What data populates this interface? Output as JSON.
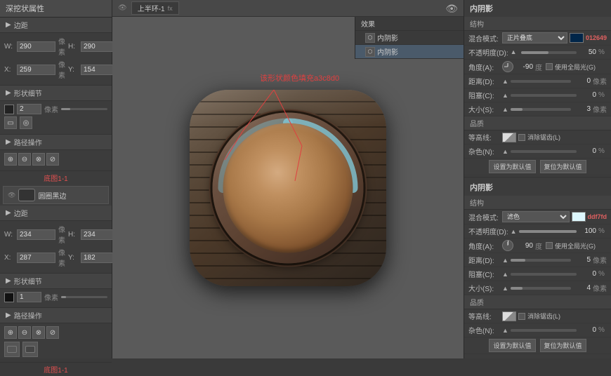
{
  "leftPanel": {
    "title": "深挖状属性",
    "sections": [
      {
        "id": "section1",
        "header": "边距",
        "fields": [
          {
            "label": "W:",
            "value": "290",
            "unit": "像素",
            "label2": "H:",
            "value2": "290",
            "unit2": "像素"
          },
          {
            "label": "X:",
            "value": "259",
            "unit": "像素",
            "label2": "Y:",
            "value2": "154",
            "unit2": "像素"
          }
        ]
      },
      {
        "id": "section2",
        "header": "形状细节",
        "strokeValue": "2",
        "strokeUnit": "像素"
      },
      {
        "id": "section3",
        "header": "路径操作"
      }
    ],
    "layerItem": "圆圈黑边",
    "section4Header": "边距",
    "section4Fields": [
      {
        "label": "W:",
        "value": "234",
        "unit": "像素",
        "label2": "H:",
        "value2": "234",
        "unit2": "像素"
      },
      {
        "label": "X:",
        "value": "287",
        "unit": "像素",
        "label2": "Y:",
        "value2": "182",
        "unit2": "像素"
      }
    ],
    "section5Header": "形状细节",
    "strokeValue2": "1",
    "strokeUnit2": "像素",
    "section6Header": "路径操作",
    "bottomRed1": "底图1-1",
    "bottomRed2": "底图1-1"
  },
  "effectsTree": {
    "layerName": "上半环-1",
    "items": [
      {
        "label": "效果",
        "indent": 0
      },
      {
        "label": "内阴影",
        "indent": 1
      },
      {
        "label": "内阴影",
        "indent": 1
      }
    ]
  },
  "annotation": {
    "text": "该形状颜色填充a3c8d0"
  },
  "rightPanel": {
    "title": "内阴影",
    "section1": {
      "header": "结构",
      "rows": [
        {
          "label": "混合模式:",
          "value": "正片叠底",
          "colorHex": "012649",
          "color": "#012649"
        },
        {
          "label": "不透明度(D):",
          "value": "50",
          "unit": "%"
        },
        {
          "label": "角度(A):",
          "dialAngle": -90,
          "value": "-90",
          "unit": "度",
          "checkbox": "使用全局光(G)"
        },
        {
          "label": "距离(D):",
          "value": "0",
          "unit": "像素"
        },
        {
          "label": "阻塞(C):",
          "value": "0",
          "unit": "%"
        },
        {
          "label": "大小(S):",
          "value": "3",
          "unit": "像素"
        }
      ],
      "qualityHeader": "品质",
      "qualityRows": [
        {
          "label": "等高线:",
          "checkbox": "消除锯齿(L)"
        },
        {
          "label": "杂色(N):",
          "value": "0",
          "unit": "%"
        }
      ],
      "btnDefault": "设置为默认值",
      "btnReset": "复位为默认值"
    },
    "section2": {
      "title": "内阴影",
      "header": "结构",
      "rows": [
        {
          "label": "混合模式:",
          "value": "滤色",
          "colorHex": "ddf7fd",
          "color": "#ddf7fd"
        },
        {
          "label": "不透明度(D):",
          "value": "100",
          "unit": "%"
        },
        {
          "label": "角度(A):",
          "dialAngle": 90,
          "value": "90",
          "unit": "度",
          "checkbox": "使用全局光(G)"
        },
        {
          "label": "距离(D):",
          "value": "5",
          "unit": "像素"
        },
        {
          "label": "阻塞(C):",
          "value": "0",
          "unit": "%"
        },
        {
          "label": "大小(S):",
          "value": "4",
          "unit": "像素"
        }
      ],
      "qualityHeader": "品质",
      "qualityRows": [
        {
          "label": "等高线:",
          "checkbox": "消除锯齿(L)"
        },
        {
          "label": "杂色(N):",
          "value": "0",
          "unit": "%"
        }
      ],
      "btnDefault": "设置为默认值",
      "btnReset": "复位为默认值"
    }
  },
  "canvas": {
    "eyeIcon": "👁",
    "hexTag1": "012649",
    "hexTag2": "ddf7fd"
  }
}
